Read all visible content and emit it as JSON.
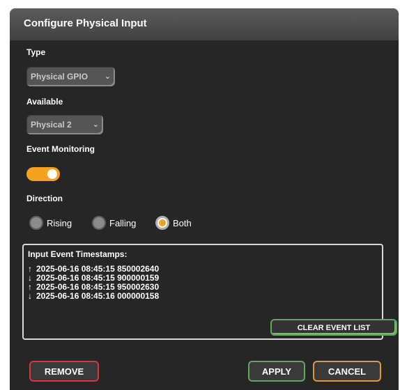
{
  "dialog": {
    "title": "Configure Physical Input"
  },
  "type": {
    "label": "Type",
    "selected": "Physical GPIO"
  },
  "available": {
    "label": "Available",
    "selected": "Physical 2"
  },
  "event_monitoring": {
    "label": "Event Monitoring",
    "enabled": true
  },
  "direction": {
    "label": "Direction",
    "options": [
      "Rising",
      "Falling",
      "Both"
    ],
    "selected": "Both"
  },
  "events": {
    "title": "Input Event Timestamps:",
    "items": [
      {
        "arrow": "↑",
        "text": "2025-06-16 08:45:15 850002640"
      },
      {
        "arrow": "↓",
        "text": "2025-06-16 08:45:15 900000159"
      },
      {
        "arrow": "↑",
        "text": "2025-06-16 08:45:15 950002630"
      },
      {
        "arrow": "↓",
        "text": "2025-06-16 08:45:16 000000158"
      }
    ],
    "clear_label": "CLEAR EVENT LIST"
  },
  "footer": {
    "remove_label": "REMOVE",
    "apply_label": "APPLY",
    "cancel_label": "CANCEL"
  },
  "colors": {
    "accent": "#f4a21f",
    "apply_border": "#5fa95a",
    "remove_border": "#d9363e",
    "cancel_border": "#e8943a"
  },
  "icons": {
    "dropdown": "chevron-down-icon",
    "rising": "arrow-up-icon",
    "falling": "arrow-down-icon"
  }
}
